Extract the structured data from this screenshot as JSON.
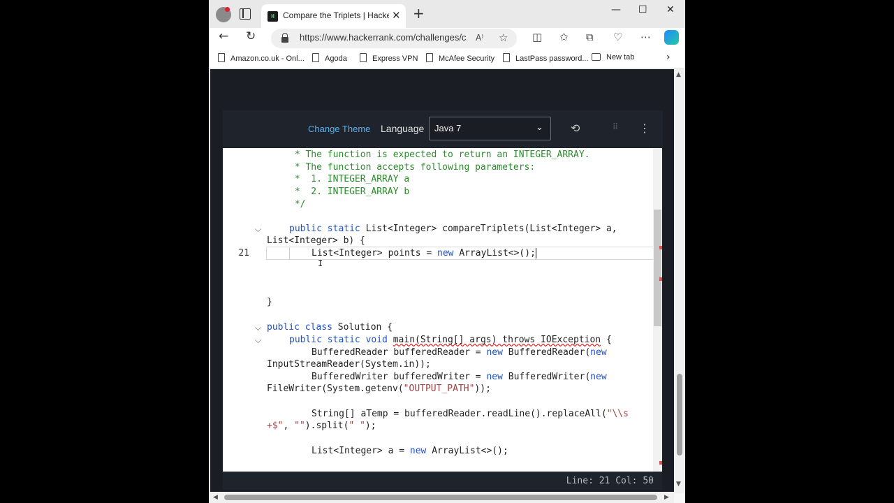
{
  "browser": {
    "tab_title": "Compare the Triplets | HackerRank",
    "favicon_text": "H",
    "url": "https://www.hackerrank.com/challenges/c...",
    "bookmarks": [
      {
        "label": "Amazon.co.uk - Onl..."
      },
      {
        "label": "Agoda"
      },
      {
        "label": "Express VPN"
      },
      {
        "label": "McAfee Security"
      },
      {
        "label": "LastPass password..."
      },
      {
        "label": "New tab"
      }
    ]
  },
  "editor": {
    "change_theme": "Change Theme",
    "language_label": "Language",
    "language_value": "Java 7",
    "current_line_number": "21",
    "status": "Line: 21  Col: 50",
    "code": {
      "c1": " * The function is expected to return an INTEGER_ARRAY.",
      "c2": " * The function accepts following parameters:",
      "c3": " *  1. INTEGER_ARRAY a",
      "c4": " *  2. INTEGER_ARRAY b",
      "c5": " */",
      "l6a": "public static",
      "l6b": " List<Integer> compareTriplets(List<Integer> a,",
      "l7": "List<Integer> b) {",
      "l8a": "List<Integer> points = ",
      "l8b": "new",
      "l8c": " ArrayList<>();",
      "l9": "}",
      "l10a": "public class",
      "l10b": " Solution {",
      "l11a": "public static void",
      "l11b": "main(String[] args) throws IOException",
      "l11c": " {",
      "l12a": "BufferedReader bufferedReader = ",
      "l12b": "new",
      "l12c": " BufferedReader(",
      "l12d": "new",
      "l13": "InputStreamReader(System.in));",
      "l14a": "BufferedWriter bufferedWriter = ",
      "l14b": "new",
      "l14c": " BufferedWriter(",
      "l14d": "new",
      "l15a": "FileWriter(System.getenv(",
      "l15b": "\"OUTPUT_PATH\"",
      "l15c": "));",
      "l16a": "String[] aTemp = bufferedReader.readLine().replaceAll(",
      "l16b": "\"\\\\s",
      "l17a": "+$\"",
      "l17b": ", ",
      "l17c": "\"\"",
      "l17d": ").split(",
      "l17e": "\" \"",
      "l17f": ");",
      "l18a": "List<Integer> a = ",
      "l18b": "new",
      "l18c": " ArrayList<>();"
    }
  },
  "colors": {
    "keyword": "#1e50c8",
    "comment": "#2d8b2d",
    "string": "#a04040",
    "link": "#5ab0e8"
  }
}
